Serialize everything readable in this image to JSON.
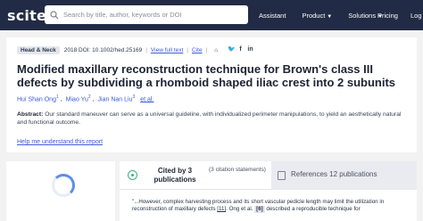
{
  "navbar": {
    "logo": "scite_",
    "search_placeholder": "Search by title, author, keywords or DOI",
    "links": [
      "Assistant",
      "Product",
      "Solutions"
    ],
    "pricing": "Pricing",
    "login": "Log in",
    "bg_color": "#222b45"
  },
  "article": {
    "journal": "Head & Neck",
    "year_doi": "2018 DOI: 10.1002/hed.25169",
    "full_text": "View full text",
    "cite": "Cite",
    "title": "Modified maxillary reconstruction technique for Brown's class III defects by subdividing a rhomboid shaped iliac crest into 2 subunits",
    "authors": [
      {
        "name": "Hui Shan Ong",
        "sup": "1"
      },
      {
        "name": "Miao Yu",
        "sup": "2"
      },
      {
        "name": "Jian Nan Liu",
        "sup": "3"
      }
    ],
    "et_al": "et al.",
    "abstract_label": "Abstract:",
    "abstract_text": "Our standard maneuver can serve as a universal guideline, with individualized perimeter manipulations, to yield an aesthetically natural and functional outcome.",
    "help_link": "Help me understand this report"
  },
  "tabs": {
    "cited_by": "Cited by 3 publications",
    "citation_statements": "(3 citation statements)",
    "references": "References 12 publications"
  },
  "snippet": {
    "part1": "\"...However, complex harvesting process and its short vascular pedicle length may limit the utilization in reconstruction of maxillary defects ",
    "ref1": "[11]",
    "part2": ". Ong et al. ",
    "tag": "[6]",
    "part3": " described a reproducible technique for"
  },
  "icons": [
    "search-icon",
    "chevron-down-icon",
    "bookmark-icon",
    "twitter-icon",
    "facebook-icon",
    "linkedin-icon",
    "citing-icon",
    "references-icon",
    "loading-spinner"
  ]
}
